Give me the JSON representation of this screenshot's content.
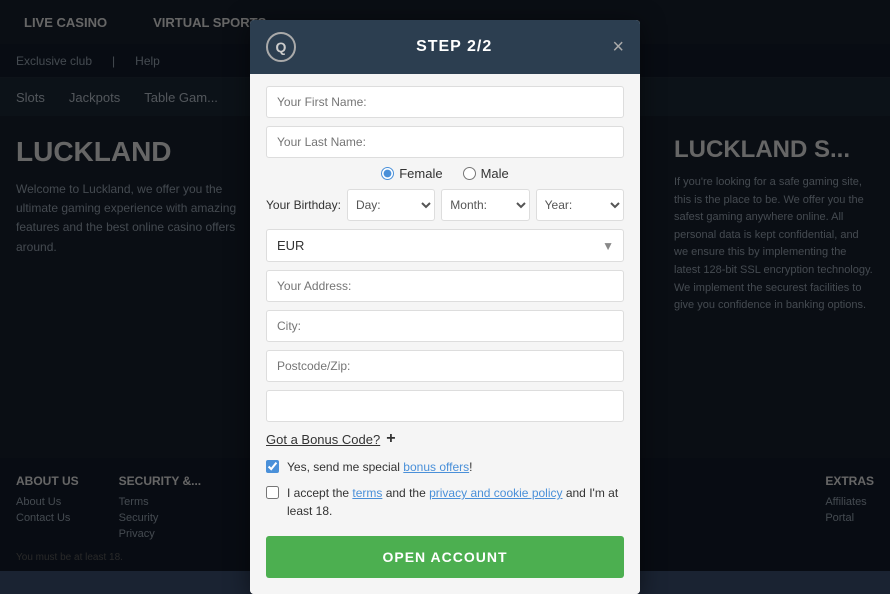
{
  "nav": {
    "items": [
      {
        "label": "LIVE CASINO"
      },
      {
        "label": "VIRTUAL SPORTS"
      }
    ]
  },
  "subnav": {
    "items": [
      {
        "label": "Exclusive club"
      },
      {
        "label": "Help"
      }
    ]
  },
  "categories": {
    "items": [
      {
        "label": "Slots"
      },
      {
        "label": "Jackpots"
      },
      {
        "label": "Table Gam..."
      }
    ]
  },
  "left_brand": {
    "title": "LUCKLAND",
    "text": "Welcome to Luckland, we offer you the ultimate gaming experience with amazing features and the best online casino offers around."
  },
  "right_brand": {
    "title": "LUCKLAND S...",
    "text": "If you're looking for a safe gaming site, this is the place to be. We offer you the safest gaming anywhere online. All personal data is kept confidential, and we ensure this by implementing the latest 128-bit SSL encryption technology. We implement the securest facilities to give you confidence in banking options."
  },
  "footer": {
    "about_title": "ABOUT US",
    "about_links": [
      "About Us",
      "Contact Us"
    ],
    "security_title": "SECURITY &...",
    "security_links": [
      "Terms",
      "Security",
      "Privacy"
    ],
    "extras_title": "EXTRAS",
    "extras_links": [
      "Affiliates",
      "Portal"
    ],
    "disclaimer": "You must be at least 18."
  },
  "modal": {
    "title": "STEP 2/2",
    "close_label": "×",
    "first_name_placeholder": "Your First Name:",
    "last_name_placeholder": "Your Last Name:",
    "gender_female": "Female",
    "gender_male": "Male",
    "birthday_label": "Your Birthday:",
    "day_placeholder": "Day:",
    "month_placeholder": "Month:",
    "year_placeholder": "Year:",
    "currency_value": "EUR",
    "address_placeholder": "Your Address:",
    "city_placeholder": "City:",
    "postcode_placeholder": "Postcode/Zip:",
    "bonus_code_text": "Got a Bonus Code?",
    "bonus_code_plus": "+",
    "checkbox1_text": "Yes, send me special ",
    "checkbox1_link": "bonus offers",
    "checkbox1_suffix": "!",
    "checkbox2_prefix": "I accept the ",
    "checkbox2_terms": "terms",
    "checkbox2_middle": " and the ",
    "checkbox2_policy": "privacy and cookie policy",
    "checkbox2_suffix": " and I'm at least 18.",
    "open_account_btn": "OPEN ACCOUNT"
  }
}
